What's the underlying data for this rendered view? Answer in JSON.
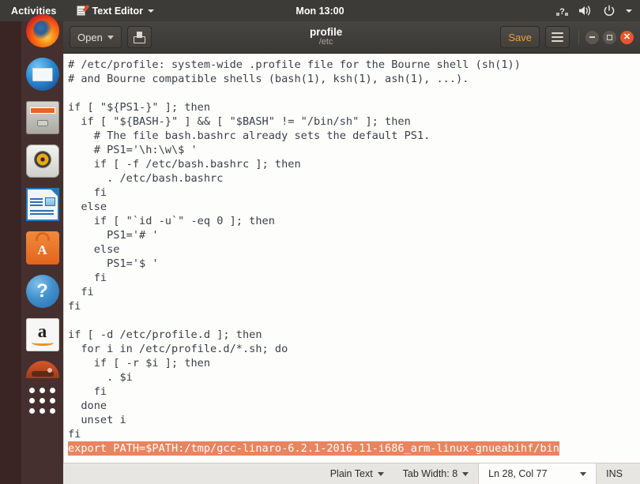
{
  "top_panel": {
    "activities": "Activities",
    "app_name": "Text Editor",
    "app_icon": "notepad-icon",
    "clock": "Mon 13:00",
    "tray": [
      {
        "name": "network-unknown-icon",
        "glyph": "?"
      },
      {
        "name": "volume-icon",
        "glyph": "▶"
      },
      {
        "name": "power-icon",
        "glyph": "⏻"
      },
      {
        "name": "system-menu-caret-icon",
        "glyph": "▾"
      }
    ]
  },
  "launcher": {
    "items": [
      {
        "name": "firefox",
        "label": "Firefox"
      },
      {
        "name": "thunderbird",
        "label": "Thunderbird Mail"
      },
      {
        "name": "files",
        "label": "Files"
      },
      {
        "name": "rhythmbox",
        "label": "Rhythmbox"
      },
      {
        "name": "libreoffice-writer",
        "label": "LibreOffice Writer"
      },
      {
        "name": "ubuntu-software",
        "label": "Ubuntu Software",
        "letter": "A"
      },
      {
        "name": "help",
        "label": "Help",
        "letter": "?"
      },
      {
        "name": "amazon",
        "label": "Amazon",
        "letter": "a"
      },
      {
        "name": "partial-app",
        "label": ""
      }
    ],
    "show_applications": "Show Applications"
  },
  "window": {
    "open_label": "Open",
    "new_doc_tooltip": "Create a new document",
    "title": "profile",
    "path": "/etc",
    "save_label": "Save",
    "menu_tooltip": "Main menu",
    "minimize": "–",
    "maximize": "□",
    "close": "×"
  },
  "editor": {
    "lines": [
      "# /etc/profile: system-wide .profile file for the Bourne shell (sh(1))",
      "# and Bourne compatible shells (bash(1), ksh(1), ash(1), ...).",
      "",
      "if [ \"${PS1-}\" ]; then",
      "  if [ \"${BASH-}\" ] && [ \"$BASH\" != \"/bin/sh\" ]; then",
      "    # The file bash.bashrc already sets the default PS1.",
      "    # PS1='\\h:\\w\\$ '",
      "    if [ -f /etc/bash.bashrc ]; then",
      "      . /etc/bash.bashrc",
      "    fi",
      "  else",
      "    if [ \"`id -u`\" -eq 0 ]; then",
      "      PS1='# '",
      "    else",
      "      PS1='$ '",
      "    fi",
      "  fi",
      "fi",
      "",
      "if [ -d /etc/profile.d ]; then",
      "  for i in /etc/profile.d/*.sh; do",
      "    if [ -r $i ]; then",
      "      . $i",
      "    fi",
      "  done",
      "  unset i",
      "fi"
    ],
    "highlighted_line": "export PATH=$PATH:/tmp/gcc-linaro-6.2.1-2016.11-i686_arm-linux-gnueabihf/bin",
    "highlight_color": "#e8845e"
  },
  "statusbar": {
    "language": "Plain Text",
    "tab_width": "Tab Width: 8",
    "position": "Ln 28, Col 77",
    "insert_mode": "INS"
  }
}
